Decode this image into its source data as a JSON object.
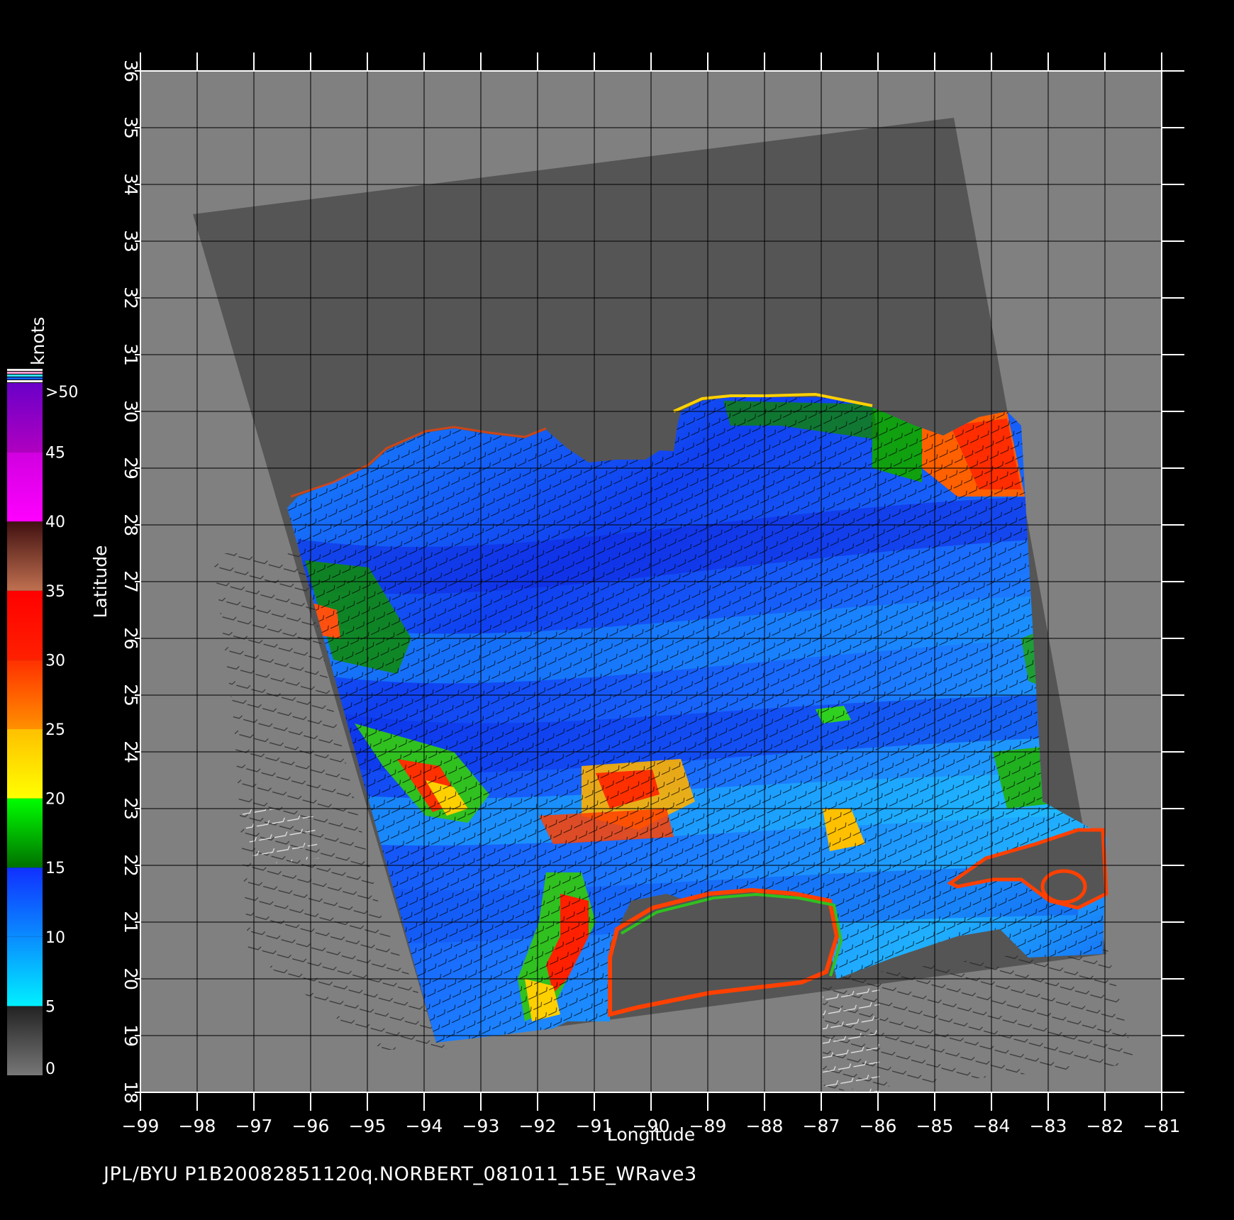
{
  "map": {
    "x_axis": {
      "title": "Longitude",
      "range": [
        -99,
        -81
      ],
      "ticks": [
        -99,
        -98,
        -97,
        -96,
        -95,
        -94,
        -93,
        -92,
        -91,
        -90,
        -89,
        -88,
        -87,
        -86,
        -85,
        -84,
        -83,
        -82,
        -81
      ]
    },
    "y_axis": {
      "title": "Latitude",
      "range": [
        18,
        36
      ],
      "ticks": [
        18,
        19,
        20,
        21,
        22,
        23,
        24,
        25,
        26,
        27,
        28,
        29,
        30,
        31,
        32,
        33,
        34,
        35,
        36
      ]
    },
    "grid": true,
    "colors": {
      "background": "#000000",
      "no_data": "#808080",
      "land_swath": "#555555",
      "grid_line": "#000000"
    }
  },
  "colorbar": {
    "unit": "knots",
    "labels": [
      "0",
      "5",
      "10",
      "15",
      "20",
      "25",
      "30",
      "35",
      "40",
      "45",
      ">50"
    ],
    "bands": [
      {
        "from": 0,
        "to": 5,
        "colors": [
          "#777777",
          "#222222"
        ]
      },
      {
        "from": 5,
        "to": 10,
        "colors": [
          "#00f0ff",
          "#0a8cff"
        ]
      },
      {
        "from": 10,
        "to": 15,
        "colors": [
          "#0a8cff",
          "#1030ff"
        ]
      },
      {
        "from": 15,
        "to": 20,
        "colors": [
          "#007000",
          "#00ff00"
        ]
      },
      {
        "from": 20,
        "to": 25,
        "colors": [
          "#ffff00",
          "#ffc000"
        ]
      },
      {
        "from": 25,
        "to": 30,
        "colors": [
          "#ff9000",
          "#ff3000"
        ]
      },
      {
        "from": 30,
        "to": 35,
        "colors": [
          "#ff2000",
          "#ff0000"
        ]
      },
      {
        "from": 35,
        "to": 40,
        "colors": [
          "#c07050",
          "#401010"
        ]
      },
      {
        "from": 40,
        "to": 45,
        "colors": [
          "#ff00ff",
          "#d000e0"
        ]
      },
      {
        "from": 45,
        "to": 50,
        "colors": [
          "#b000c0",
          "#6a00c8"
        ]
      }
    ]
  },
  "footer": "JPL/BYU  P1B20082851120q.NORBERT_081011_15E_WRave3"
}
